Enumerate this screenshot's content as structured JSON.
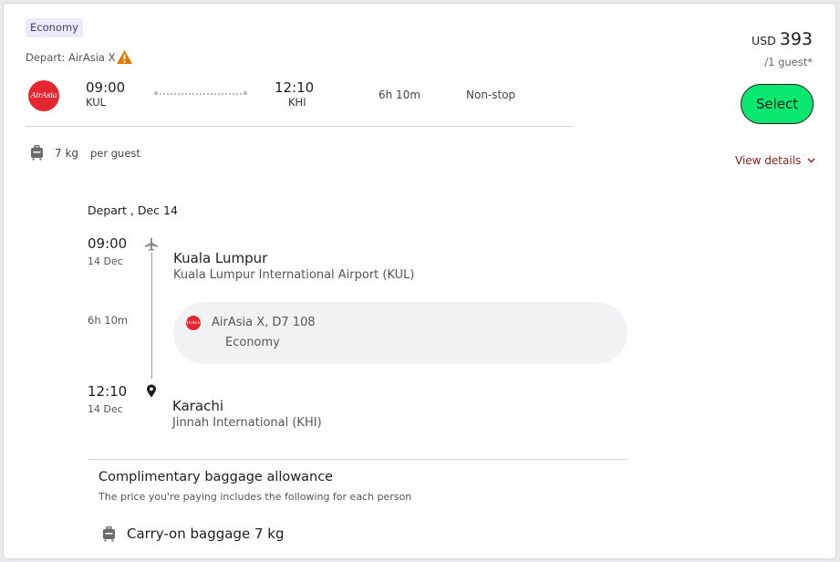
{
  "fare": {
    "cabin_badge": "Economy",
    "depart_label": "Depart: AirAsia X",
    "warning_icon": "warning-icon"
  },
  "itinerary": {
    "airline_logo_text": "AirAsia",
    "depart_time": "09:00",
    "depart_code": "KUL",
    "arrive_time": "12:10",
    "arrive_code": "KHI",
    "duration": "6h 10m",
    "stops": "Non-stop"
  },
  "baggage_summary": {
    "weight": "7 kg",
    "per": "per guest"
  },
  "price": {
    "currency": "USD",
    "amount": "393",
    "per_guest": "/1 guest*"
  },
  "actions": {
    "select_label": "Select",
    "view_details_label": "View details"
  },
  "details": {
    "segment_date": "Depart , Dec 14",
    "origin": {
      "time": "09:00",
      "date": "14 Dec",
      "city": "Kuala Lumpur",
      "airport": "Kuala Lumpur International Airport (KUL)"
    },
    "flight": {
      "duration": "6h 10m",
      "airline_logo_text": "AirAsia",
      "flight_number": "AirAsia X, D7 108",
      "cabin": "Economy"
    },
    "destination": {
      "time": "12:10",
      "date": "14 Dec",
      "city": "Karachi",
      "airport": "Jinnah International (KHI)"
    }
  },
  "baggage": {
    "title": "Complimentary baggage allowance",
    "subtitle": "The price you're paying includes the following for each person",
    "carry_on": "Carry-on baggage 7 kg"
  },
  "colors": {
    "select_button": "#0be86f",
    "brand_red": "#e3262f",
    "link": "#8b1a1a",
    "warning": "#e07b00"
  }
}
